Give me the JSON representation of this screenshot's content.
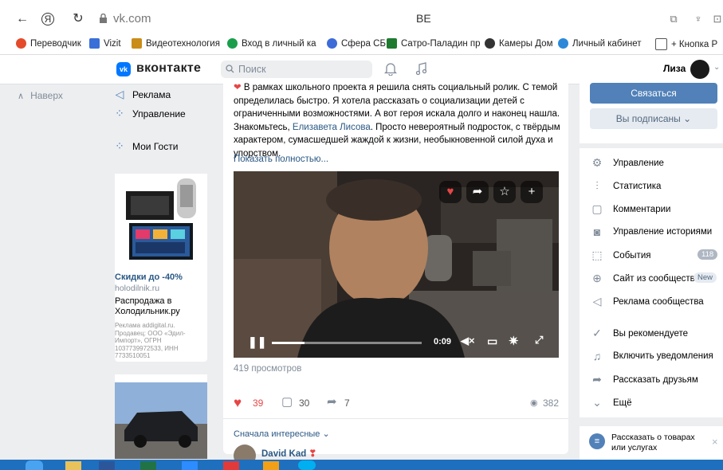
{
  "browser": {
    "url": "vk.com",
    "title": "ВЕ",
    "bookmarks": [
      {
        "label": "Переводчик",
        "color": "#e44b2b"
      },
      {
        "label": "Vizit",
        "color": "#3a6fd8"
      },
      {
        "label": "Видеотехнология",
        "color": "#c98d18"
      },
      {
        "label": "Вход в личный ка",
        "color": "#1b9e4b"
      },
      {
        "label": "Сфера СБ",
        "color": "#3d6bd8"
      },
      {
        "label": "Сатро-Паладин пр",
        "color": "#1e7a2f"
      },
      {
        "label": "Камеры Дом",
        "color": "#333333"
      },
      {
        "label": "Личный кабинет",
        "color": "#2b88d8"
      },
      {
        "label": "+ Кнопка Р",
        "color": "#555555"
      }
    ]
  },
  "vk": {
    "logo": "vk",
    "brand": "вконтакте",
    "search_placeholder": "Поиск",
    "user_name": "Лиза"
  },
  "left": {
    "back": "Наверх",
    "items": [
      "Реклама",
      "Управление",
      "Мои Гости"
    ]
  },
  "ad": {
    "discount": "Скидки до -40%",
    "domain": "holodilnik.ru",
    "title": "Распродажа в Холодильник.ру",
    "legal": "Реклама addigital.ru. Продавец: ООО «Эдил-Импорт», ОГРН 1037739972533, ИНН 7733510051"
  },
  "post": {
    "text_before_link": "В рамках школьного проекта я решила снять социальный ролик. С темой определилась быстро. Я хотела рассказать о социализации детей с ограниченными возможностями. А вот героя искала долго и наконец нашла. Знакомьтесь, ",
    "link": "Елизавета Лисова",
    "text_after_link": ". Просто невероятный подросток, с твёрдым характером, сумасшедшей жаждой к жизни, необыкновенной силой духа и упорством.",
    "show_more": "Показать полностью...",
    "video_time": "0:09",
    "video_progress": 0.22,
    "views_label": "419 просмотров",
    "likes": "39",
    "comments": "30",
    "shares": "7",
    "views": "382",
    "sort_label": "Сначала интересные",
    "commenter": "David Kad"
  },
  "right": {
    "contact": "Связаться",
    "subscribed": "Вы подписаны",
    "menu": [
      {
        "icon": "gear-icon",
        "label": "Управление"
      },
      {
        "icon": "stats-icon",
        "label": "Статистика"
      },
      {
        "icon": "comment-icon",
        "label": "Комментарии"
      },
      {
        "icon": "stories-icon",
        "label": "Управление историями"
      },
      {
        "icon": "events-icon",
        "label": "События",
        "badge": "118"
      },
      {
        "icon": "globe-icon",
        "label": "Сайт из сообщества",
        "tag": "New"
      },
      {
        "icon": "megaphone-icon",
        "label": "Реклама сообщества"
      },
      {
        "icon": "check-icon",
        "label": "Вы рекомендуете"
      },
      {
        "icon": "bell-icon",
        "label": "Включить уведомления"
      },
      {
        "icon": "share-icon",
        "label": "Рассказать друзьям"
      },
      {
        "icon": "chevron-icon",
        "label": "Ещё"
      }
    ],
    "promo": "Рассказать о товарах или услугах"
  }
}
